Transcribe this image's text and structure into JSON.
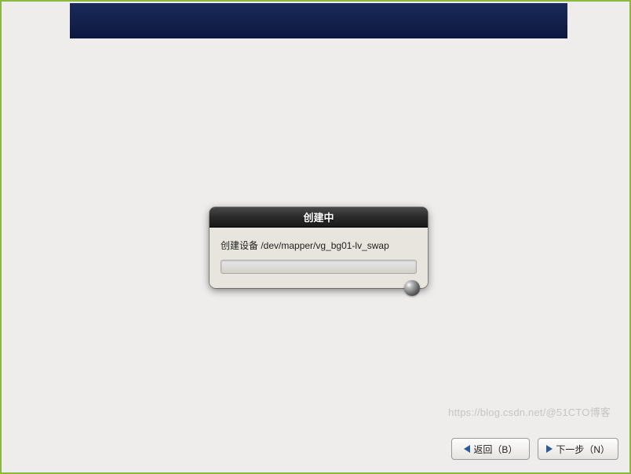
{
  "dialog": {
    "title": "创建中",
    "message": "创建设备 /dev/mapper/vg_bg01-lv_swap"
  },
  "buttons": {
    "back_label": "返回（B）",
    "next_label": "下一步（N）"
  },
  "watermark": "https://blog.csdn.net/@51CTO博客"
}
